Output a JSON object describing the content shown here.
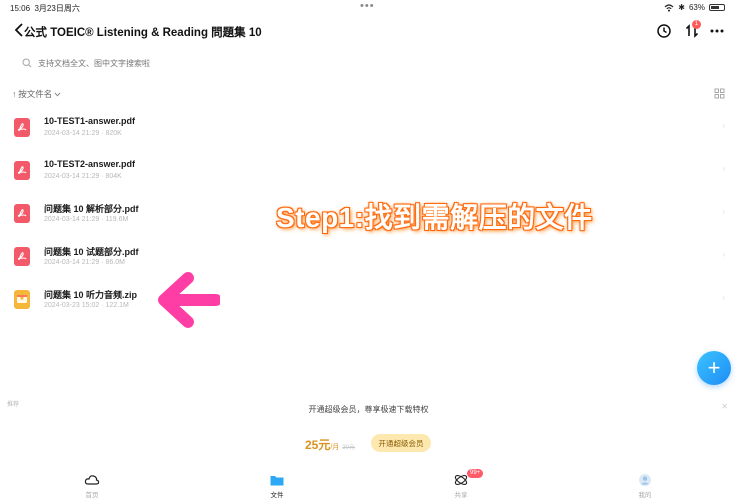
{
  "status_bar": {
    "time": "15:06",
    "date": "3月23日周六",
    "dots": "•••",
    "battery": "63%"
  },
  "header": {
    "title": "公式 TOEIC® Listening & Reading 問題集 10",
    "badge": "1"
  },
  "search": {
    "placeholder": "支持文档全文、图中文字搜索啦"
  },
  "sort": {
    "label": "按文件名"
  },
  "files": [
    {
      "name": "10-TEST1-answer.pdf",
      "meta": "2024-03-14 21:29 · 820K",
      "type": "pdf"
    },
    {
      "name": "10-TEST2-answer.pdf",
      "meta": "2024-03-14 21:29 · 804K",
      "type": "pdf"
    },
    {
      "name": "问题集 10 解析部分.pdf",
      "meta": "2024-03-14 21:29 · 119.6M",
      "type": "pdf"
    },
    {
      "name": "问题集 10 试题部分.pdf",
      "meta": "2024-03-14 21:29 · 86.0M",
      "type": "pdf"
    },
    {
      "name": "问题集 10 听力音频.zip",
      "meta": "2024-03-23 15:02 · 122.1M",
      "type": "zip"
    }
  ],
  "annotation": {
    "text": "Step1:找到需解压的文件"
  },
  "promo": {
    "ad_tag": "推荐",
    "text": "开通超级会员，尊享极速下载特权",
    "price": "25元",
    "unit": "/月",
    "old_price": "30元",
    "button": "开通超级会员"
  },
  "bottom_nav": {
    "items": [
      {
        "label": "首页"
      },
      {
        "label": "文件"
      },
      {
        "label": "共享"
      },
      {
        "label": "我的"
      }
    ],
    "share_badge": "99+"
  },
  "colors": {
    "accent": "#1d8cf5",
    "pdf": "#f25a6a",
    "zip": "#f4b73a",
    "annotation_outline": "#ff5a00",
    "arrow": "#ff3ea5"
  }
}
